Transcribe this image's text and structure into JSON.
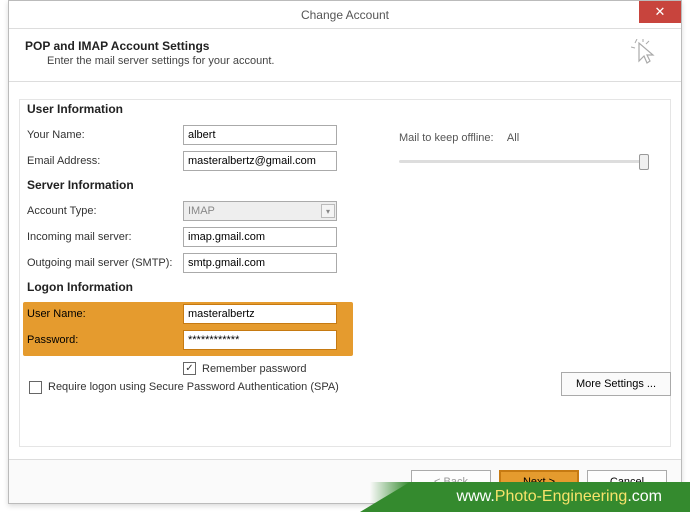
{
  "window": {
    "title": "Change Account"
  },
  "header": {
    "title": "POP and IMAP Account Settings",
    "subtitle": "Enter the mail server settings for your account."
  },
  "sections": {
    "user_info": "User Information",
    "server_info": "Server Information",
    "logon_info": "Logon Information"
  },
  "labels": {
    "your_name": "Your Name:",
    "email": "Email Address:",
    "account_type": "Account Type:",
    "incoming": "Incoming mail server:",
    "outgoing": "Outgoing mail server (SMTP):",
    "user_name": "User Name:",
    "password": "Password:",
    "remember": "Remember password",
    "spa": "Require logon using Secure Password Authentication (SPA)",
    "mail_keep": "Mail to keep offline:",
    "mail_keep_val": "All"
  },
  "values": {
    "your_name": "albert",
    "email": "masteralbertz@gmail.com",
    "account_type": "IMAP",
    "incoming": "imap.gmail.com",
    "outgoing": "smtp.gmail.com",
    "user_name": "masteralbertz",
    "password": "************"
  },
  "buttons": {
    "more": "More Settings ...",
    "back": "< Back",
    "next": "Next >",
    "cancel": "Cancel"
  },
  "banner": {
    "www": "www.",
    "site": "Photo-Engineering",
    "tld": ".com"
  }
}
